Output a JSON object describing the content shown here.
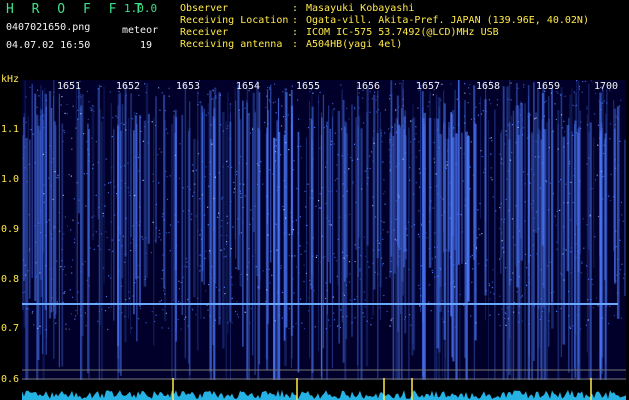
{
  "header": {
    "app_title": "H R O F F T",
    "version": "1.0.0",
    "filename": "0407021650.png",
    "timestamp": "04.07.02 16:50",
    "counter_label": "meteor",
    "counter_value": "19",
    "info": [
      {
        "key": "Observer",
        "value": "Masayuki Kobayashi"
      },
      {
        "key": "Receiving Location",
        "value": "Ogata-vill. Akita-Pref. JAPAN (139.96E, 40.02N)"
      },
      {
        "key": "Receiver",
        "value": "ICOM IC-575 53.7492(@LCD)MHz USB"
      },
      {
        "key": "Receiving antenna",
        "value": "A504HB(yagi 4el)"
      }
    ],
    "separator": ":"
  },
  "plot": {
    "y_unit": "kHz",
    "y_ticks": [
      "1.1",
      "1.0",
      "0.9",
      "0.8",
      "0.7",
      "0.6"
    ],
    "x_ticks": [
      "1651",
      "1652",
      "1653",
      "1654",
      "1655",
      "1656",
      "1657",
      "1658",
      "1659",
      "1700"
    ],
    "colors": {
      "background": "#00002a",
      "signal": "#4c7aff",
      "carrier": "#6aa8ff",
      "noise": "#29c7ff",
      "label_yellow": "#ffe94a",
      "title_green": "#3fe08a"
    }
  }
}
